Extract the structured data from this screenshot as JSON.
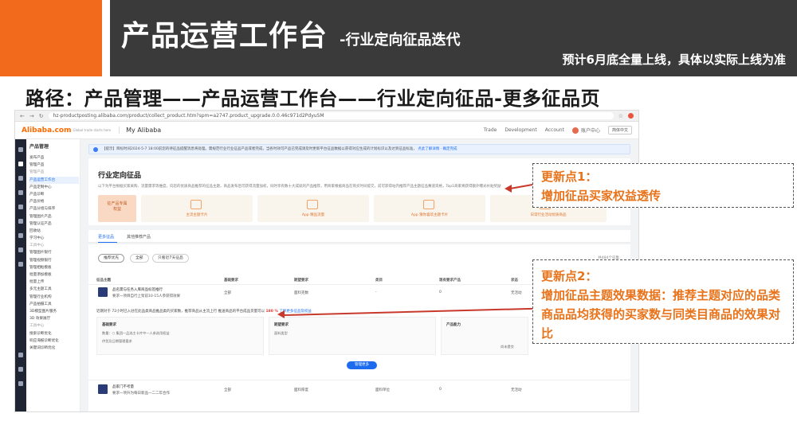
{
  "slide": {
    "title": "产品运营工作台",
    "subtitle": "-行业定向征品迭代",
    "release_note": "预计6月底全量上线，具体以实际上线为准",
    "path": "路径：产品管理——产品运营工作台——行业定向征品-更多征品页"
  },
  "browser": {
    "url": "hz-productposting.alibaba.com/product/collect_product.htm?spm=a2747.product_upgrade.0.0.46c971d2PdyuSM"
  },
  "app_header": {
    "logo": "Alibaba.com",
    "logo_sub": "Global trade starts here",
    "section": "My Alibaba",
    "links": [
      "Trade",
      "Development",
      "Account"
    ],
    "user": "账户中心",
    "lang": "简体中文"
  },
  "sidebar": {
    "title": "产品管理",
    "items": [
      "发布产品",
      "管理产品",
      "管理产品",
      "产品运营工作台",
      "产品定制中心",
      "产品诊断",
      "产品价格",
      "产品分组与排序",
      "管理图片产品",
      "管理认证产品",
      "回收站",
      "学习中心",
      "工具中心",
      "管理图片银行",
      "管理视频银行",
      "管理相框模板",
      "批量添加模板",
      "批量上传",
      "多元主题工具",
      "管理行业机构",
      "产品拍摄工具",
      "3D模型图片服务",
      "3D 效果展厅",
      "工具中心",
      "搜索诊断优化",
      "响应海报诊断优化",
      "关键词诊断优化"
    ]
  },
  "notice": {
    "text": "【提示】目标时间2024-5-7 18:00前您的待征品提醒消息将处理。需规范行业行业征品产品或者完成，当各时效可产品已完成请及时更新平台征品数据以获得对应生成的计划标识以及达到征品标准，",
    "link": "点此了解详情 · 确定完成"
  },
  "panel": {
    "title": "行业定向征品",
    "desc": "以下为平台根据买家采购、流量需求等维度，向您的优质商品推荐的征品主题，商品发布后可获得流量加权，同时享有数十大成就的产品推荐，用商家根据商品在购买时间提交，前可获得站内推荐产品主题征品赛道资格，Top1商家将获得额外曝光补贴奖励",
    "first_card": [
      "征产品专属",
      "权益"
    ],
    "cards": [
      "主流主题卡片",
      "App 精品流量",
      "App 猜你喜欢主题卡片",
      "日常行业活动优质商品"
    ]
  },
  "tabs": [
    "更多征品",
    "其他推荐产品"
  ],
  "filters": [
    "推荐优先",
    "全部",
    "只看近7天征品"
  ],
  "count_label": "共484个征集",
  "table": {
    "headers": [
      "征品主题",
      "基础要求",
      "期望要求",
      "类目",
      "现有要求产品",
      "状态"
    ],
    "rows": [
      {
        "title": "品名需与任务入库商品标签推行",
        "sub": "要求一项目自行上架前10-15人参获得效果",
        "req": "全部",
        "expect": "面料克数",
        "category": "-",
        "existing": "0",
        "status": "无活动"
      },
      {
        "title": "品家门不考量",
        "sub": "要求一项升为每日新品一二二年合作",
        "req": "全部",
        "expect": "面料厚度",
        "category": "面料单位",
        "existing": "0",
        "status": "无活动"
      }
    ],
    "stat_line": "近期对于 72小时已入驻在此品类商品推品类的买家数，推荐商品从主流上行 推送商品的平台成品货量可以",
    "stat_highlight": "180 %",
    "stat_link": "了解更多征品及权益",
    "sub_box_1": {
      "head": "基础要求",
      "t1": "数量：○ 集团一品选主卡片中一人参选用权益",
      "t2": "供货及日期管理要求"
    },
    "sub_box_2": {
      "head": "期望要求",
      "t1": "面料类型"
    },
    "sub_box_3": {
      "head": "产品能力",
      "t1": "尚未提交"
    },
    "more_button": "管理更多"
  },
  "callouts": {
    "c1_title": "更新点1：",
    "c1_body": "增加征品买家权益透传",
    "c2_title": "更新点2：",
    "c2_body": "增加征品主题效果数据：推荐主题对应的品类商品品均获得的买家数与同类目商品的效果对比"
  },
  "colors": {
    "accent_orange": "#f26a1b",
    "dark_band": "#3a3a3a",
    "callout_text": "#e8731a",
    "arrow": "#c8392b",
    "link_blue": "#1d6cf0"
  }
}
